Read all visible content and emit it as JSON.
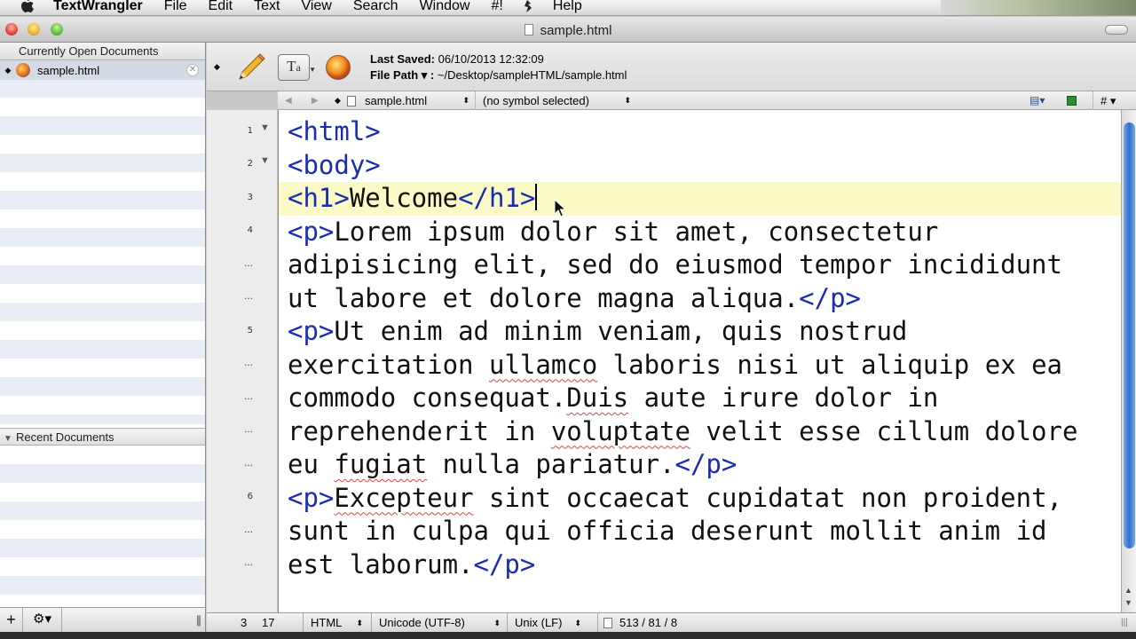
{
  "menubar": {
    "app": "TextWrangler",
    "items": [
      "File",
      "Edit",
      "Text",
      "View",
      "Search",
      "Window",
      "#!",
      "Help"
    ]
  },
  "window": {
    "title": "sample.html"
  },
  "sidebar": {
    "open_header": "Currently Open Documents",
    "open_items": [
      {
        "label": "sample.html",
        "icon": "firefox-icon"
      }
    ],
    "recent_header": "Recent Documents",
    "footer": {
      "add": "+",
      "gear": "⚙▾",
      "grip": "|||"
    }
  },
  "docinfo": {
    "saved_label": "Last Saved:",
    "saved_value": "06/10/2013 12:32:09",
    "path_label": "File Path ▾ :",
    "path_value": "~/Desktop/sampleHTML/sample.html",
    "text_tool": "T",
    "text_tool_sub": "a"
  },
  "navbar": {
    "back": "◀",
    "forward": "▶",
    "file": "sample.html",
    "symbol": "(no symbol selected)",
    "hash": "# ▾",
    "updown": "⬍"
  },
  "gutter": {
    "lines": [
      "1",
      "2",
      "3",
      "4",
      "…",
      "…",
      "5",
      "…",
      "…",
      "…",
      "…",
      "6",
      "…",
      "…"
    ]
  },
  "editor": {
    "lines": [
      [
        {
          "t": "<html>",
          "c": "tag"
        }
      ],
      [
        {
          "t": "<body>",
          "c": "tag"
        }
      ],
      [
        {
          "t": "<h1>",
          "c": "tag"
        },
        {
          "t": "Welcome"
        },
        {
          "t": "</h1>",
          "c": "tag"
        }
      ],
      [
        {
          "t": "<p>",
          "c": "tag"
        },
        {
          "t": "Lorem ipsum dolor sit amet, consectetur"
        }
      ],
      [
        {
          "t": "adipisicing elit, sed do eiusmod tempor incididunt"
        }
      ],
      [
        {
          "t": "ut labore et dolore magna aliqua."
        },
        {
          "t": "</p>",
          "c": "tag"
        }
      ],
      [
        {
          "t": "<p>",
          "c": "tag"
        },
        {
          "t": "Ut enim ad minim veniam, quis nostrud"
        }
      ],
      [
        {
          "t": "exercitation "
        },
        {
          "t": "ullamco",
          "c": "sp"
        },
        {
          "t": " laboris nisi ut aliquip ex ea"
        }
      ],
      [
        {
          "t": "commodo consequat."
        },
        {
          "t": "Duis",
          "c": "sp"
        },
        {
          "t": " aute irure dolor in"
        }
      ],
      [
        {
          "t": "reprehenderit in "
        },
        {
          "t": "voluptate",
          "c": "sp"
        },
        {
          "t": " velit esse cillum dolore"
        }
      ],
      [
        {
          "t": "eu "
        },
        {
          "t": "fugiat",
          "c": "sp"
        },
        {
          "t": " nulla pariatur."
        },
        {
          "t": "</p>",
          "c": "tag"
        }
      ],
      [
        {
          "t": "<p>",
          "c": "tag"
        },
        {
          "t": "Excepteur",
          "c": "sp"
        },
        {
          "t": " sint occaecat cupidatat non proident,"
        }
      ],
      [
        {
          "t": "sunt in culpa qui officia deserunt mollit anim id"
        }
      ],
      [
        {
          "t": "est laborum."
        },
        {
          "t": "</p>",
          "c": "tag"
        }
      ]
    ],
    "current_line_index": 2
  },
  "status": {
    "line": "3",
    "column": "17",
    "language": "HTML",
    "encoding": "Unicode (UTF-8)",
    "line_endings": "Unix (LF)",
    "counts": "513 / 81 / 8",
    "updown": "⬍",
    "grip": "|||"
  },
  "colors": {
    "tag": "#1b2cae",
    "current_line_highlight": "#fbf9c6",
    "spelling_underline": "#d64545",
    "scroll_thumb": "#2f6fd3"
  }
}
